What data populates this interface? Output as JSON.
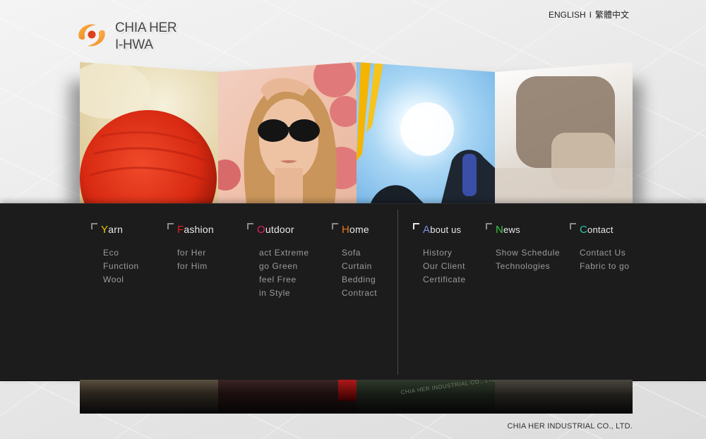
{
  "header": {
    "logo_line1": "CHIA HER",
    "logo_line2": "I-HWA",
    "lang_english": "ENGLISH",
    "lang_separator": "I",
    "lang_chinese": "繁體中文"
  },
  "menu": {
    "columns": [
      {
        "first": "Y",
        "rest": "arn",
        "accent": "#f2c200",
        "items": [
          "Eco",
          "Function",
          "Wool"
        ]
      },
      {
        "first": "F",
        "rest": "ashion",
        "accent": "#e0201c",
        "items": [
          "for Her",
          "for Him"
        ]
      },
      {
        "first": "O",
        "rest": "utdoor",
        "accent": "#e0245c",
        "items": [
          "act Extreme",
          "go Green",
          "feel Free",
          "in Style"
        ]
      },
      {
        "first": "H",
        "rest": "ome",
        "accent": "#e8761a",
        "items": [
          "Sofa",
          "Curtain",
          "Bedding",
          "Contract"
        ]
      },
      {
        "first": "A",
        "rest": "bout us",
        "accent": "#7e8ee0",
        "items": [
          "History",
          "Our Client",
          "Certificate"
        ]
      },
      {
        "first": "N",
        "rest": "ews",
        "accent": "#3cc34a",
        "items": [
          "Show Schedule",
          "Technologies"
        ]
      },
      {
        "first": "C",
        "rest": "ontact",
        "accent": "#2cc4a8",
        "items": [
          "Contact Us",
          "Fabric to go"
        ]
      }
    ]
  },
  "reflection_text": "CHIA HER INDUSTRIAL CO., LTD.",
  "footer": {
    "company": "CHIA HER INDUSTRIAL CO., LTD."
  },
  "colors": {
    "band": "#1c1c1c",
    "logo_orange": "#f08a1c",
    "logo_red": "#e03a1a"
  }
}
